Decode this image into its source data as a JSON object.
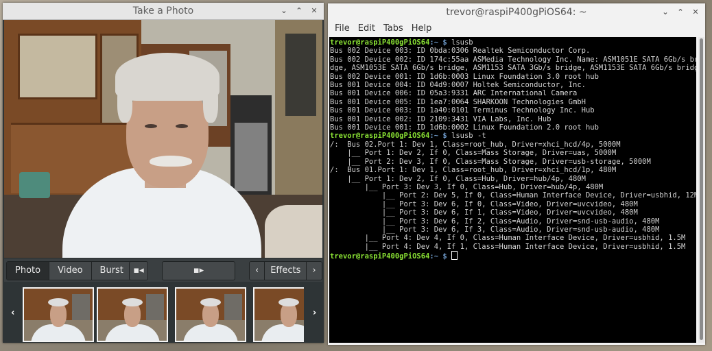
{
  "photo_window": {
    "title": "Take a Photo",
    "controls": {
      "minimize": "⌄",
      "maximize": "⌃",
      "close": "✕"
    },
    "modes": [
      "Photo",
      "Video",
      "Burst"
    ],
    "active_mode": "Photo",
    "effects_label": "Effects",
    "thumbnail_count": 4
  },
  "terminal": {
    "title": "trevor@raspiP400gPiOS64: ~",
    "menu": [
      "File",
      "Edit",
      "Tabs",
      "Help"
    ],
    "prompt_user": "trevor@raspiP400gPiOS64",
    "prompt_path": ":~ $",
    "lines": [
      {
        "type": "prompt",
        "cmd": " lsusb"
      },
      {
        "type": "out",
        "text": "Bus 002 Device 003: ID 0bda:0306 Realtek Semiconductor Corp."
      },
      {
        "type": "out",
        "text": "Bus 002 Device 002: ID 174c:55aa ASMedia Technology Inc. Name: ASM1051E SATA 6Gb/s bri"
      },
      {
        "type": "out",
        "text": "dge, ASM1053E SATA 6Gb/s bridge, ASM1153 SATA 3Gb/s bridge, ASM1153E SATA 6Gb/s bridge"
      },
      {
        "type": "out",
        "text": "Bus 002 Device 001: ID 1d6b:0003 Linux Foundation 3.0 root hub"
      },
      {
        "type": "out",
        "text": "Bus 001 Device 004: ID 04d9:0007 Holtek Semiconductor, Inc."
      },
      {
        "type": "out",
        "text": "Bus 001 Device 006: ID 05a3:9331 ARC International Camera"
      },
      {
        "type": "out",
        "text": "Bus 001 Device 005: ID 1ea7:0064 SHARKOON Technologies GmbH"
      },
      {
        "type": "out",
        "text": "Bus 001 Device 003: ID 1a40:0101 Terminus Technology Inc. Hub"
      },
      {
        "type": "out",
        "text": "Bus 001 Device 002: ID 2109:3431 VIA Labs, Inc. Hub"
      },
      {
        "type": "out",
        "text": "Bus 001 Device 001: ID 1d6b:0002 Linux Foundation 2.0 root hub"
      },
      {
        "type": "prompt",
        "cmd": " lsusb -t"
      },
      {
        "type": "out",
        "text": "/:  Bus 02.Port 1: Dev 1, Class=root_hub, Driver=xhci_hcd/4p, 5000M"
      },
      {
        "type": "out",
        "text": "    |__ Port 1: Dev 2, If 0, Class=Mass Storage, Driver=uas, 5000M"
      },
      {
        "type": "out",
        "text": "    |__ Port 2: Dev 3, If 0, Class=Mass Storage, Driver=usb-storage, 5000M"
      },
      {
        "type": "out",
        "text": "/:  Bus 01.Port 1: Dev 1, Class=root_hub, Driver=xhci_hcd/1p, 480M"
      },
      {
        "type": "out",
        "text": "    |__ Port 1: Dev 2, If 0, Class=Hub, Driver=hub/4p, 480M"
      },
      {
        "type": "out",
        "text": "        |__ Port 3: Dev 3, If 0, Class=Hub, Driver=hub/4p, 480M"
      },
      {
        "type": "out",
        "text": "            |__ Port 2: Dev 5, If 0, Class=Human Interface Device, Driver=usbhid, 12M"
      },
      {
        "type": "out",
        "text": "            |__ Port 3: Dev 6, If 0, Class=Video, Driver=uvcvideo, 480M"
      },
      {
        "type": "out",
        "text": "            |__ Port 3: Dev 6, If 1, Class=Video, Driver=uvcvideo, 480M"
      },
      {
        "type": "out",
        "text": "            |__ Port 3: Dev 6, If 2, Class=Audio, Driver=snd-usb-audio, 480M"
      },
      {
        "type": "out",
        "text": "            |__ Port 3: Dev 6, If 3, Class=Audio, Driver=snd-usb-audio, 480M"
      },
      {
        "type": "out",
        "text": "        |__ Port 4: Dev 4, If 0, Class=Human Interface Device, Driver=usbhid, 1.5M"
      },
      {
        "type": "out",
        "text": "        |__ Port 4: Dev 4, If 1, Class=Human Interface Device, Driver=usbhid, 1.5M"
      },
      {
        "type": "prompt",
        "cmd": " ",
        "cursor": true
      }
    ],
    "window_controls": {
      "minimize": "⌄",
      "maximize": "⌃",
      "close": "✕"
    }
  }
}
